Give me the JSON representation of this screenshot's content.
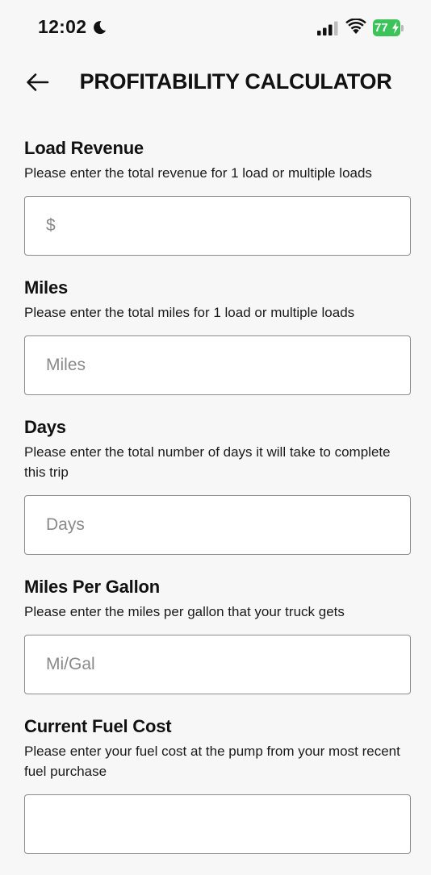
{
  "status_bar": {
    "time": "12:02",
    "battery": "77"
  },
  "header": {
    "title": "PROFITABILITY CALCULATOR"
  },
  "fields": [
    {
      "label": "Load Revenue",
      "help": "Please enter the total revenue for 1 load or multiple loads",
      "placeholder": "$",
      "value": ""
    },
    {
      "label": "Miles",
      "help": "Please enter the total miles for 1 load or multiple loads",
      "placeholder": "Miles",
      "value": ""
    },
    {
      "label": "Days",
      "help": "Please enter the total number of days it will take to complete this trip",
      "placeholder": "Days",
      "value": ""
    },
    {
      "label": "Miles Per Gallon",
      "help": "Please enter the miles per gallon that your truck gets",
      "placeholder": "Mi/Gal",
      "value": ""
    },
    {
      "label": "Current Fuel Cost",
      "help": "Please enter your fuel cost at the pump from your most recent fuel purchase",
      "placeholder": "",
      "value": ""
    }
  ],
  "colors": {
    "background": "#f7f7f7",
    "battery_green": "#3cc35a",
    "input_border": "#8c8c8c",
    "placeholder": "#8a8a8a"
  }
}
